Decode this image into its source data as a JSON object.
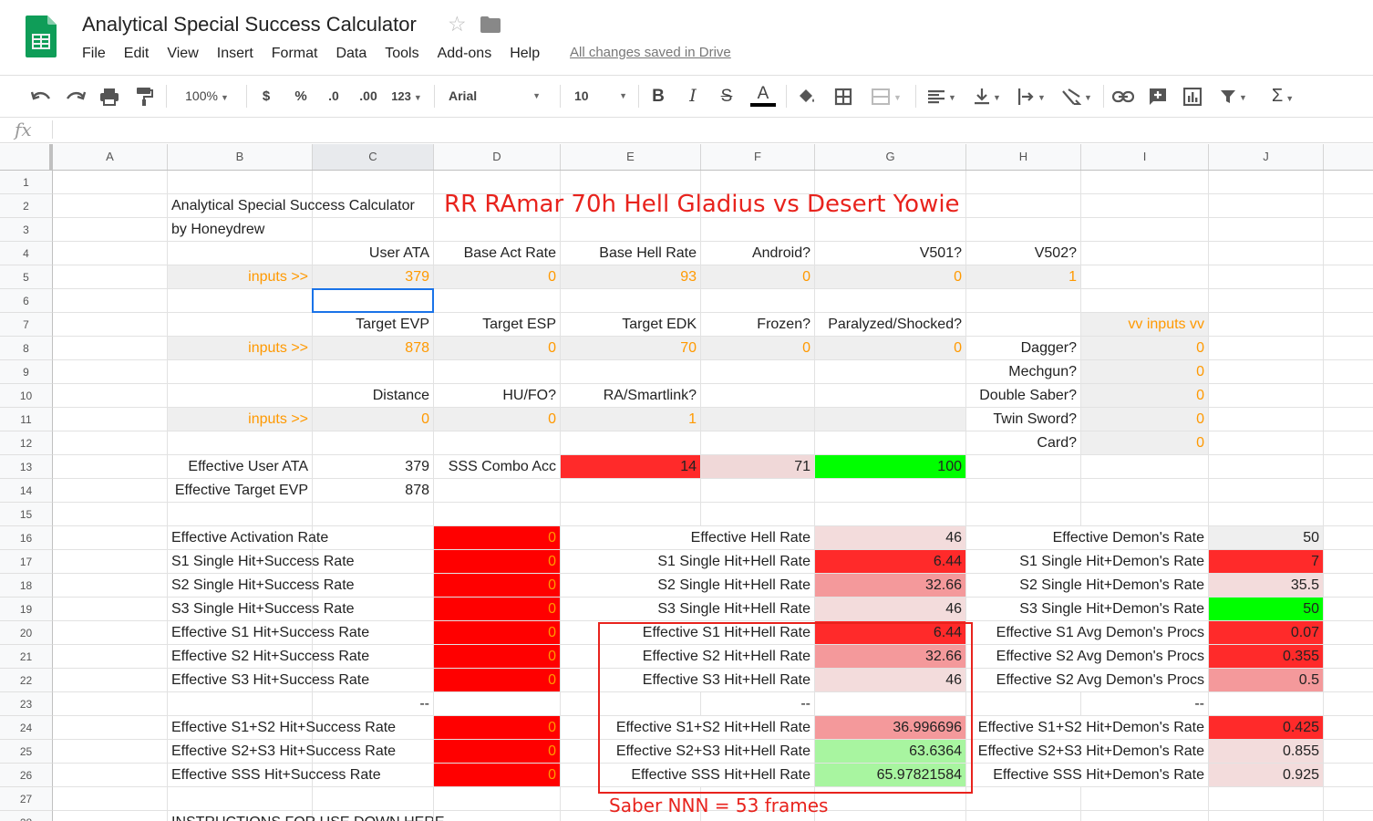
{
  "app": {
    "title": "Analytical Special Success Calculator",
    "saved_status": "All changes saved in Drive",
    "menu": [
      "File",
      "Edit",
      "View",
      "Insert",
      "Format",
      "Data",
      "Tools",
      "Add-ons",
      "Help"
    ],
    "logo_color": "#0f9d58"
  },
  "toolbar": {
    "zoom": "100%",
    "currency": "$",
    "percent": "%",
    "dec_less": ".0",
    "dec_more": ".00",
    "format_more": "123",
    "font": "Arial",
    "font_size": "10",
    "bold": "B",
    "italic": "I",
    "strike": "S",
    "text_color_glyph": "A"
  },
  "formula_bar": {
    "fx": "fx",
    "content": ""
  },
  "sheet": {
    "columns": [
      "A",
      "B",
      "C",
      "D",
      "E",
      "F",
      "G",
      "H",
      "I",
      "J"
    ],
    "selected_column": "C",
    "selected_cell": "C6",
    "row_count": 28,
    "colors": {
      "dark_red": "#ff0000",
      "red": "#ff2a2a",
      "red_mid": "#f4999b",
      "pink": "#f3dcdc",
      "light_pink": "#f0d8d8",
      "green": "#00ff00",
      "light_green": "#a8f5a0",
      "gray": "#efefef",
      "input_orange": "#ff9900"
    },
    "cells": [
      {
        "id": "B2",
        "text": "Analytical Special Success Calculator"
      },
      {
        "id": "B3",
        "text": "by Honeydrew"
      },
      {
        "id": "C4",
        "text": "User ATA",
        "align": "r"
      },
      {
        "id": "D4",
        "text": "Base Act Rate",
        "align": "r"
      },
      {
        "id": "E4",
        "text": "Base Hell Rate",
        "align": "r"
      },
      {
        "id": "F4",
        "text": "Android?",
        "align": "r"
      },
      {
        "id": "G4",
        "text": "V501?",
        "align": "r"
      },
      {
        "id": "H4",
        "text": "V502?",
        "align": "r"
      },
      {
        "id": "B5",
        "text": "inputs >>",
        "align": "r",
        "color": "o",
        "bg": "gray"
      },
      {
        "id": "C5",
        "text": "379",
        "align": "r",
        "color": "o",
        "bg": "gray"
      },
      {
        "id": "D5",
        "text": "0",
        "align": "r",
        "color": "o",
        "bg": "gray"
      },
      {
        "id": "E5",
        "text": "93",
        "align": "r",
        "color": "o",
        "bg": "gray"
      },
      {
        "id": "F5",
        "text": "0",
        "align": "r",
        "color": "o",
        "bg": "gray"
      },
      {
        "id": "G5",
        "text": "0",
        "align": "r",
        "color": "o",
        "bg": "gray"
      },
      {
        "id": "H5",
        "text": "1",
        "align": "r",
        "color": "o",
        "bg": "gray"
      },
      {
        "id": "C7",
        "text": "Target EVP",
        "align": "r"
      },
      {
        "id": "D7",
        "text": "Target ESP",
        "align": "r"
      },
      {
        "id": "E7",
        "text": "Target EDK",
        "align": "r"
      },
      {
        "id": "F7",
        "text": "Frozen?",
        "align": "r"
      },
      {
        "id": "G7",
        "text": "Paralyzed/Shocked?",
        "align": "r"
      },
      {
        "id": "I7",
        "text": "vv inputs vv",
        "align": "r",
        "color": "o",
        "bg": "gray"
      },
      {
        "id": "B8",
        "text": "inputs >>",
        "align": "r",
        "color": "o",
        "bg": "gray"
      },
      {
        "id": "C8",
        "text": "878",
        "align": "r",
        "color": "o",
        "bg": "gray"
      },
      {
        "id": "D8",
        "text": "0",
        "align": "r",
        "color": "o",
        "bg": "gray"
      },
      {
        "id": "E8",
        "text": "70",
        "align": "r",
        "color": "o",
        "bg": "gray"
      },
      {
        "id": "F8",
        "text": "0",
        "align": "r",
        "color": "o",
        "bg": "gray"
      },
      {
        "id": "G8",
        "text": "0",
        "align": "r",
        "color": "o",
        "bg": "gray"
      },
      {
        "id": "H8",
        "text": "Dagger?",
        "align": "r"
      },
      {
        "id": "I8",
        "text": "0",
        "align": "r",
        "color": "o",
        "bg": "gray"
      },
      {
        "id": "H9",
        "text": "Mechgun?",
        "align": "r"
      },
      {
        "id": "I9",
        "text": "0",
        "align": "r",
        "color": "o",
        "bg": "gray"
      },
      {
        "id": "C10",
        "text": "Distance",
        "align": "r"
      },
      {
        "id": "D10",
        "text": "HU/FO?",
        "align": "r"
      },
      {
        "id": "E10",
        "text": "RA/Smartlink?",
        "align": "r"
      },
      {
        "id": "H10",
        "text": "Double Saber?",
        "align": "r"
      },
      {
        "id": "I10",
        "text": "0",
        "align": "r",
        "color": "o",
        "bg": "gray"
      },
      {
        "id": "B11",
        "text": "inputs >>",
        "align": "r",
        "color": "o",
        "bg": "gray"
      },
      {
        "id": "C11",
        "text": "0",
        "align": "r",
        "color": "o",
        "bg": "gray"
      },
      {
        "id": "D11",
        "text": "0",
        "align": "r",
        "color": "o",
        "bg": "gray"
      },
      {
        "id": "E11",
        "text": "1",
        "align": "r",
        "color": "o",
        "bg": "gray"
      },
      {
        "id": "F11",
        "text": "",
        "bg": "gray"
      },
      {
        "id": "G11",
        "text": "",
        "bg": "gray"
      },
      {
        "id": "H11",
        "text": "Twin Sword?",
        "align": "r"
      },
      {
        "id": "I11",
        "text": "0",
        "align": "r",
        "color": "o",
        "bg": "gray"
      },
      {
        "id": "H12",
        "text": "Card?",
        "align": "r"
      },
      {
        "id": "I12",
        "text": "0",
        "align": "r",
        "color": "o",
        "bg": "gray"
      },
      {
        "id": "B13",
        "text": "Effective User ATA",
        "align": "r"
      },
      {
        "id": "C13",
        "text": "379",
        "align": "r"
      },
      {
        "id": "D13",
        "text": "SSS Combo Acc",
        "align": "r"
      },
      {
        "id": "E13",
        "text": "14",
        "align": "r",
        "bg": "red"
      },
      {
        "id": "F13",
        "text": "71",
        "align": "r",
        "bg": "light_pink"
      },
      {
        "id": "G13",
        "text": "100",
        "align": "r",
        "bg": "green"
      },
      {
        "id": "B14",
        "text": "Effective Target EVP",
        "align": "r"
      },
      {
        "id": "C14",
        "text": "878",
        "align": "r"
      },
      {
        "id": "B16",
        "text": "Effective Activation Rate",
        "align": "r"
      },
      {
        "id": "D16",
        "text": "0",
        "align": "r",
        "color": "o",
        "bg": "dark_red"
      },
      {
        "id": "E16",
        "text": "Effective Hell Rate",
        "align": "r",
        "span": 2
      },
      {
        "id": "G16",
        "text": "46",
        "align": "r",
        "bg": "pink"
      },
      {
        "id": "H16",
        "text": "Effective Demon's Rate",
        "align": "r",
        "span": 2
      },
      {
        "id": "J16",
        "text": "50",
        "align": "r",
        "bg": "gray"
      },
      {
        "id": "B17",
        "text": "S1 Single Hit+Success Rate",
        "align": "r"
      },
      {
        "id": "D17",
        "text": "0",
        "align": "r",
        "color": "o",
        "bg": "dark_red"
      },
      {
        "id": "E17",
        "text": "S1 Single Hit+Hell Rate",
        "align": "r",
        "span": 2
      },
      {
        "id": "G17",
        "text": "6.44",
        "align": "r",
        "bg": "red"
      },
      {
        "id": "H17",
        "text": "S1 Single Hit+Demon's Rate",
        "align": "r",
        "span": 2
      },
      {
        "id": "J17",
        "text": "7",
        "align": "r",
        "bg": "red"
      },
      {
        "id": "B18",
        "text": "S2 Single Hit+Success Rate",
        "align": "r"
      },
      {
        "id": "D18",
        "text": "0",
        "align": "r",
        "color": "o",
        "bg": "dark_red"
      },
      {
        "id": "E18",
        "text": "S2 Single Hit+Hell Rate",
        "align": "r",
        "span": 2
      },
      {
        "id": "G18",
        "text": "32.66",
        "align": "r",
        "bg": "red_mid"
      },
      {
        "id": "H18",
        "text": "S2 Single Hit+Demon's Rate",
        "align": "r",
        "span": 2
      },
      {
        "id": "J18",
        "text": "35.5",
        "align": "r",
        "bg": "pink"
      },
      {
        "id": "B19",
        "text": "S3 Single Hit+Success Rate",
        "align": "r"
      },
      {
        "id": "D19",
        "text": "0",
        "align": "r",
        "color": "o",
        "bg": "dark_red"
      },
      {
        "id": "E19",
        "text": "S3 Single Hit+Hell Rate",
        "align": "r",
        "span": 2
      },
      {
        "id": "G19",
        "text": "46",
        "align": "r",
        "bg": "pink"
      },
      {
        "id": "H19",
        "text": "S3 Single Hit+Demon's Rate",
        "align": "r",
        "span": 2
      },
      {
        "id": "J19",
        "text": "50",
        "align": "r",
        "bg": "green"
      },
      {
        "id": "B20",
        "text": "Effective S1 Hit+Success Rate",
        "align": "r"
      },
      {
        "id": "D20",
        "text": "0",
        "align": "r",
        "color": "o",
        "bg": "dark_red"
      },
      {
        "id": "E20",
        "text": "Effective S1 Hit+Hell Rate",
        "align": "r",
        "span": 2
      },
      {
        "id": "G20",
        "text": "6.44",
        "align": "r",
        "bg": "red"
      },
      {
        "id": "H20",
        "text": "Effective S1 Avg Demon's Procs",
        "align": "r",
        "span": 2
      },
      {
        "id": "J20",
        "text": "0.07",
        "align": "r",
        "bg": "red"
      },
      {
        "id": "B21",
        "text": "Effective S2 Hit+Success Rate",
        "align": "r"
      },
      {
        "id": "D21",
        "text": "0",
        "align": "r",
        "color": "o",
        "bg": "dark_red"
      },
      {
        "id": "E21",
        "text": "Effective S2 Hit+Hell Rate",
        "align": "r",
        "span": 2
      },
      {
        "id": "G21",
        "text": "32.66",
        "align": "r",
        "bg": "red_mid"
      },
      {
        "id": "H21",
        "text": "Effective S2 Avg Demon's Procs",
        "align": "r",
        "span": 2
      },
      {
        "id": "J21",
        "text": "0.355",
        "align": "r",
        "bg": "red"
      },
      {
        "id": "B22",
        "text": "Effective S3 Hit+Success Rate",
        "align": "r"
      },
      {
        "id": "D22",
        "text": "0",
        "align": "r",
        "color": "o",
        "bg": "dark_red"
      },
      {
        "id": "E22",
        "text": "Effective S3 Hit+Hell Rate",
        "align": "r",
        "span": 2
      },
      {
        "id": "G22",
        "text": "46",
        "align": "r",
        "bg": "pink"
      },
      {
        "id": "H22",
        "text": "Effective S2 Avg Demon's Procs",
        "align": "r",
        "span": 2
      },
      {
        "id": "J22",
        "text": "0.5",
        "align": "r",
        "bg": "red_mid"
      },
      {
        "id": "C23",
        "text": "--",
        "align": "r"
      },
      {
        "id": "F23",
        "text": "--",
        "align": "r"
      },
      {
        "id": "I23",
        "text": "--",
        "align": "r"
      },
      {
        "id": "B24",
        "text": "Effective S1+S2 Hit+Success Rate",
        "align": "r"
      },
      {
        "id": "D24",
        "text": "0",
        "align": "r",
        "color": "o",
        "bg": "dark_red"
      },
      {
        "id": "E24",
        "text": "Effective S1+S2 Hit+Hell Rate",
        "align": "r",
        "span": 2
      },
      {
        "id": "G24",
        "text": "36.996696",
        "align": "r",
        "bg": "red_mid"
      },
      {
        "id": "H24",
        "text": "Effective S1+S2 Hit+Demon's Rate",
        "align": "r",
        "span": 2
      },
      {
        "id": "J24",
        "text": "0.425",
        "align": "r",
        "bg": "red"
      },
      {
        "id": "B25",
        "text": "Effective S2+S3 Hit+Success Rate",
        "align": "r"
      },
      {
        "id": "D25",
        "text": "0",
        "align": "r",
        "color": "o",
        "bg": "dark_red"
      },
      {
        "id": "E25",
        "text": "Effective S2+S3 Hit+Hell Rate",
        "align": "r",
        "span": 2
      },
      {
        "id": "G25",
        "text": "63.6364",
        "align": "r",
        "bg": "light_green"
      },
      {
        "id": "H25",
        "text": "Effective S2+S3 Hit+Demon's Rate",
        "align": "r",
        "span": 2
      },
      {
        "id": "J25",
        "text": "0.855",
        "align": "r",
        "bg": "pink"
      },
      {
        "id": "B26",
        "text": "Effective SSS Hit+Success Rate",
        "align": "r"
      },
      {
        "id": "D26",
        "text": "0",
        "align": "r",
        "color": "o",
        "bg": "dark_red"
      },
      {
        "id": "E26",
        "text": "Effective SSS Hit+Hell Rate",
        "align": "r",
        "span": 2
      },
      {
        "id": "G26",
        "text": "65.97821584",
        "align": "r",
        "bg": "light_green"
      },
      {
        "id": "H26",
        "text": "Effective SSS Hit+Demon's Rate",
        "align": "r",
        "span": 2
      },
      {
        "id": "J26",
        "text": "0.925",
        "align": "r",
        "bg": "pink"
      },
      {
        "id": "B28",
        "text": "INSTRUCTIONS FOR USE DOWN HERE"
      }
    ]
  },
  "overlays": {
    "title": "RR RAmar 70h Hell Gladius vs Desert Yowie",
    "note": "Saber NNN = 53 frames",
    "annotation_color": "#e8231d"
  }
}
